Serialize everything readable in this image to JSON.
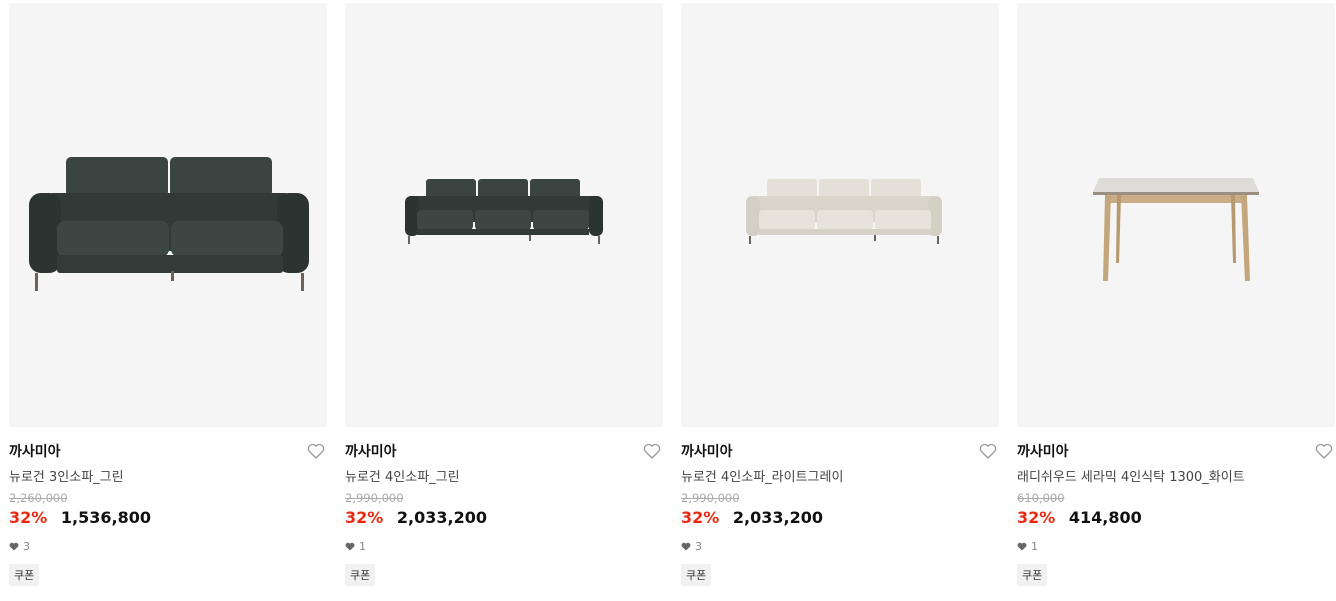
{
  "products": [
    {
      "brand": "까사미아",
      "name": "뉴로건 3인소파_그린",
      "original_price": "2,260,000",
      "discount": "32%",
      "price": "1,536,800",
      "likes": "3",
      "badge": "쿠폰",
      "image": "sofa-3seat-green"
    },
    {
      "brand": "까사미아",
      "name": "뉴로건 4인소파_그린",
      "original_price": "2,990,000",
      "discount": "32%",
      "price": "2,033,200",
      "likes": "1",
      "badge": "쿠폰",
      "image": "sofa-4seat-green"
    },
    {
      "brand": "까사미아",
      "name": "뉴로건 4인소파_라이트그레이",
      "original_price": "2,990,000",
      "discount": "32%",
      "price": "2,033,200",
      "likes": "3",
      "badge": "쿠폰",
      "image": "sofa-4seat-lightgray"
    },
    {
      "brand": "까사미아",
      "name": "래디쉬우드 세라믹 4인식탁 1300_화이트",
      "original_price": "610,000",
      "discount": "32%",
      "price": "414,800",
      "likes": "1",
      "badge": "쿠폰",
      "image": "dining-table-ceramic-white"
    }
  ],
  "colors": {
    "discount": "#ea2b14",
    "image_bg": "#f5f5f5",
    "sofa_green": "#343d39",
    "sofa_gray": "#dcd8cf"
  }
}
